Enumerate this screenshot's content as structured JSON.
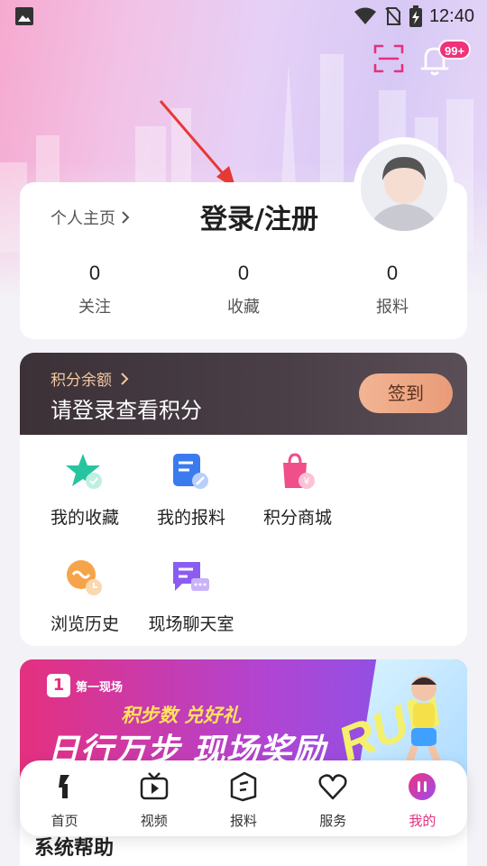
{
  "status_bar": {
    "time": "12:40"
  },
  "notifications": {
    "badge": "99+"
  },
  "profile": {
    "home_link": "个人主页",
    "login_title": "登录/注册",
    "stats": [
      {
        "value": "0",
        "label": "关注"
      },
      {
        "value": "0",
        "label": "收藏"
      },
      {
        "value": "0",
        "label": "报料"
      }
    ]
  },
  "points": {
    "balance_label": "积分余额",
    "prompt": "请登录查看积分",
    "signin_label": "签到"
  },
  "quick_links": [
    {
      "label": "我的收藏",
      "icon": "star-icon"
    },
    {
      "label": "我的报料",
      "icon": "report-icon"
    },
    {
      "label": "积分商城",
      "icon": "shopping-bag-icon"
    },
    {
      "label": "浏览历史",
      "icon": "history-clock-icon"
    },
    {
      "label": "现场聊天室",
      "icon": "chat-icon"
    }
  ],
  "banner": {
    "brand": "第一现场",
    "brand_logo": "1",
    "tagline": "积步数 兑好礼",
    "headline": "日行万步 现场奖励",
    "art_text": "RUN"
  },
  "help": {
    "title": "系统帮助"
  },
  "bottom_nav": [
    {
      "label": "首页",
      "icon": "home-icon",
      "active": false
    },
    {
      "label": "视频",
      "icon": "tv-icon",
      "active": false
    },
    {
      "label": "报料",
      "icon": "report-tab-icon",
      "active": false
    },
    {
      "label": "服务",
      "icon": "heart-icon",
      "active": false
    },
    {
      "label": "我的",
      "icon": "me-icon",
      "active": true
    }
  ],
  "colors": {
    "accent": "#e5307f",
    "signin": "#e99b78",
    "points_bg": "#3b3137"
  }
}
